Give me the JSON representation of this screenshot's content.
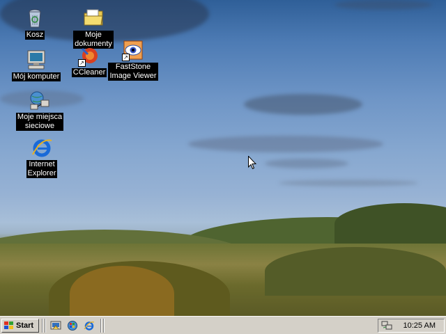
{
  "desktop": {
    "icons": [
      {
        "label_lines": [
          "Kosz"
        ],
        "icon": "recycle-bin-icon"
      },
      {
        "label_lines": [
          "Moje",
          "dokumenty"
        ],
        "icon": "folder-icon"
      },
      {
        "label_lines": [
          "Mój komputer"
        ],
        "icon": "computer-icon"
      },
      {
        "label_lines": [
          "CCleaner"
        ],
        "icon": "ccleaner-icon"
      },
      {
        "label_lines": [
          "FastStone",
          "Image Viewer"
        ],
        "icon": "faststone-icon"
      },
      {
        "label_lines": [
          "Moje miejsca",
          "sieciowe"
        ],
        "icon": "network-places-icon"
      },
      {
        "label_lines": [
          "Internet",
          "Explorer"
        ],
        "icon": "internet-explorer-icon"
      }
    ]
  },
  "taskbar": {
    "start_label": "Start",
    "quick_launch": [
      "show-desktop-icon",
      "windows-update-icon",
      "internet-explorer-icon"
    ],
    "clock": "10:25 AM",
    "tray_icon": "network-tray-icon"
  }
}
